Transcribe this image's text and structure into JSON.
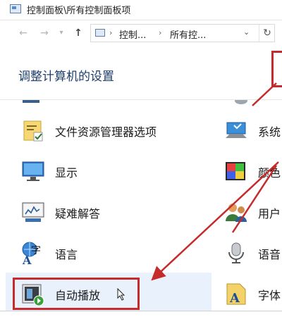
{
  "window": {
    "title": "控制面板\\所有控制面板项"
  },
  "nav": {
    "back_icon": "back-arrow-icon",
    "forward_icon": "forward-arrow-icon",
    "up_icon": "up-arrow-icon",
    "breadcrumb": [
      "控制...",
      "所有控..."
    ],
    "refresh_icon": "refresh-icon"
  },
  "main": {
    "heading": "调整计算机的设置",
    "items_left": [
      {
        "label": "文件资源管理器选项",
        "icon": "folder-options-icon"
      },
      {
        "label": "显示",
        "icon": "display-icon"
      },
      {
        "label": "疑难解答",
        "icon": "troubleshooting-icon"
      },
      {
        "label": "语言",
        "icon": "language-icon"
      },
      {
        "label": "自动播放",
        "icon": "autoplay-icon"
      }
    ],
    "items_right": [
      {
        "label": "系统",
        "icon": "system-icon"
      },
      {
        "label": "颜色",
        "icon": "color-icon"
      },
      {
        "label": "用户",
        "icon": "users-icon"
      },
      {
        "label": "语音",
        "icon": "speech-mic-icon"
      },
      {
        "label": "字体",
        "icon": "fonts-icon"
      }
    ]
  },
  "colors": {
    "annotation_red": "#c62a2a",
    "heading_blue": "#1e3e6b",
    "hover_bg": "#e9f2fc"
  }
}
